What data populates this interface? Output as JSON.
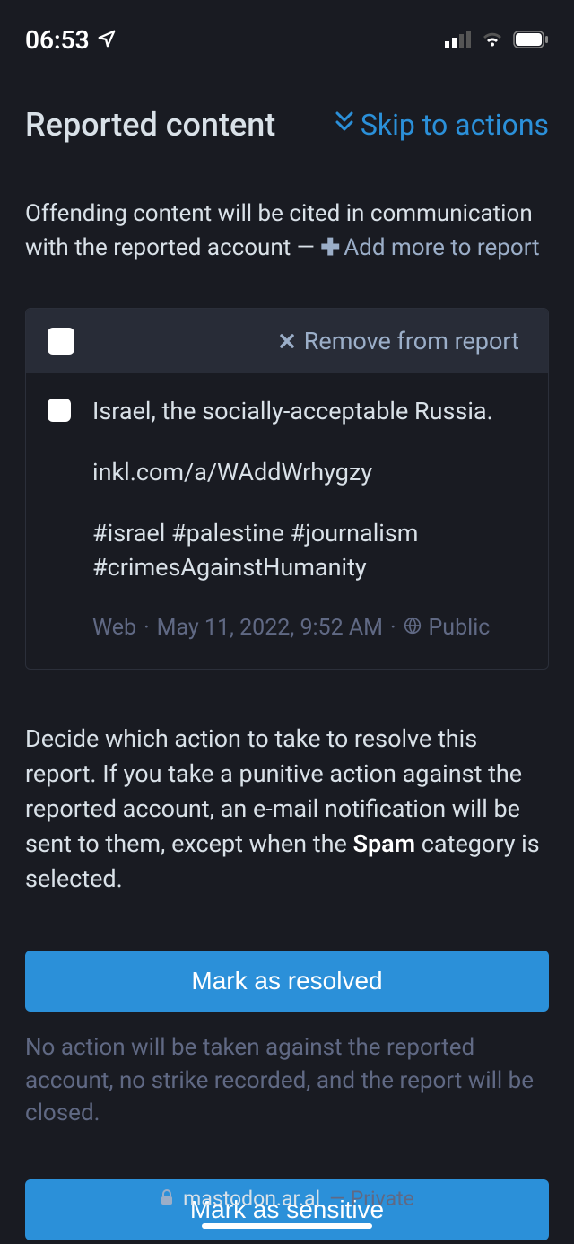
{
  "status_bar": {
    "time": "06:53"
  },
  "header": {
    "title": "Reported content",
    "skip_link": "Skip to actions"
  },
  "intro": {
    "text": "Offending content will be cited in communication with the reported account — ",
    "add_more": "Add more to report"
  },
  "post_card": {
    "remove": "Remove from report",
    "body_line1": "Israel, the socially-acceptable Russia.",
    "body_line2": "inkl.com/a/WAddWrhygzy",
    "body_line3": "#israel #palestine #journalism #crimesAgainstHumanity",
    "meta_source": "Web",
    "meta_date": "May 11, 2022, 9:52 AM",
    "meta_visibility": "Public"
  },
  "decision": {
    "text_pre": "Decide which action to take to resolve this report. If you take a punitive action against the reported account, an e-mail notification will be sent to them, except when the ",
    "text_bold": "Spam",
    "text_post": " category is selected."
  },
  "actions": {
    "resolved": {
      "label": "Mark as resolved",
      "desc": "No action will be taken against the reported account, no strike recorded, and the report will be closed."
    },
    "sensitive": {
      "label": "Mark as sensitive"
    }
  },
  "bottom": {
    "host": "mastodon.ar.al",
    "private": "— Private"
  }
}
